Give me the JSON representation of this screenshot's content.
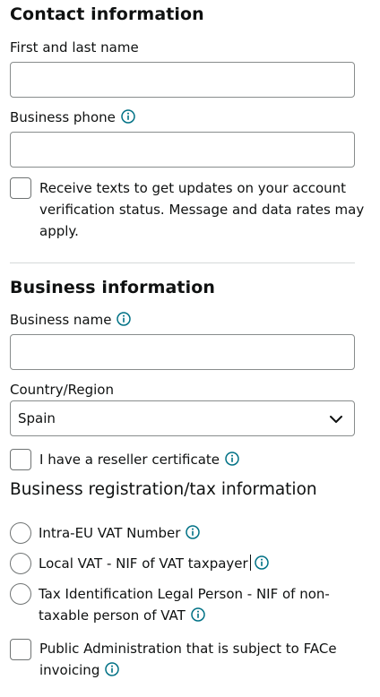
{
  "contact": {
    "heading": "Contact information",
    "name_label": "First and last name",
    "phone_label": "Business phone",
    "texts_line1": "Receive texts to get updates on your account",
    "texts_line2": "verification status. Message and data rates may",
    "texts_line3": "apply."
  },
  "business": {
    "heading": "Business information",
    "name_label": "Business name",
    "country_label": "Country/Region",
    "country_value": "Spain",
    "reseller_label": "I have a reseller certificate"
  },
  "tax": {
    "heading": "Business registration/tax information",
    "opt_intra_eu": "Intra-EU VAT Number",
    "opt_local_vat": "Local VAT - NIF of VAT taxpayer",
    "opt_legal_line1": "Tax Identification Legal Person - NIF of non-",
    "opt_legal_line2": "taxable person of VAT",
    "opt_public_line1": "Public Administration that is subject to FACe",
    "opt_public_line2": "invoicing"
  },
  "colors": {
    "info_icon": "#007185",
    "border": "#888c8c",
    "text": "#0f1111"
  }
}
